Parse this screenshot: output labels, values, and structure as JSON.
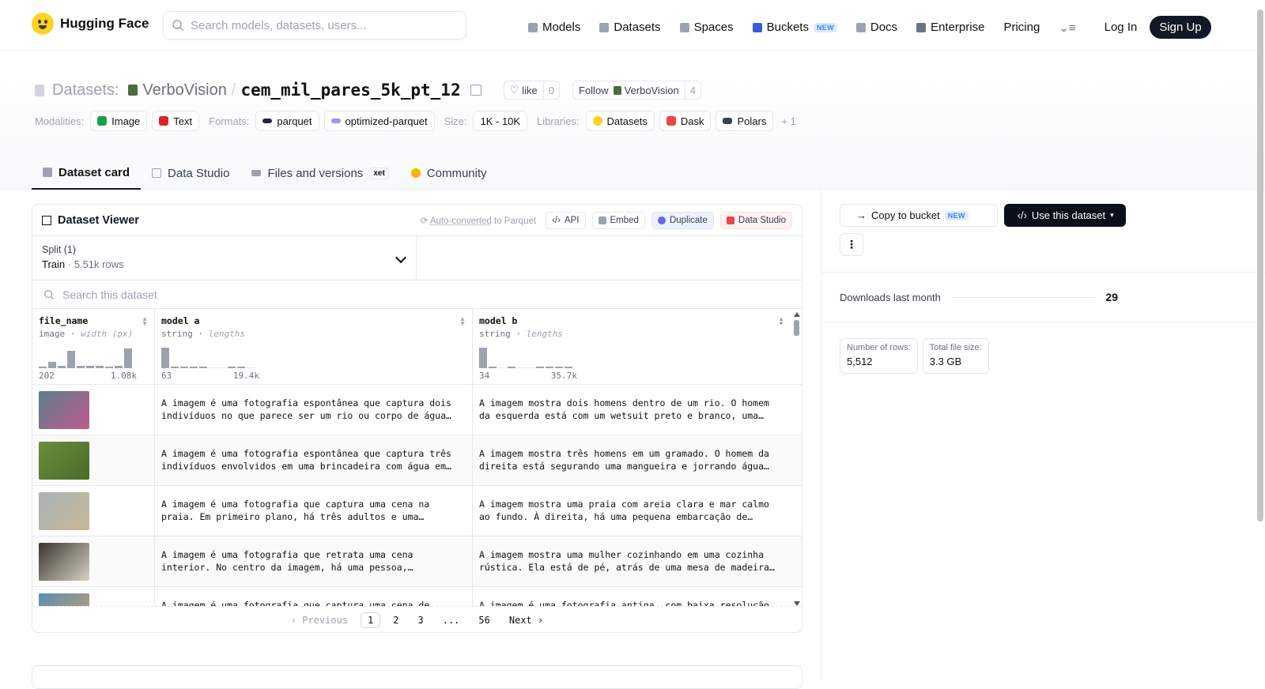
{
  "brand": {
    "name": "Hugging Face"
  },
  "search": {
    "placeholder": "Search models, datasets, users..."
  },
  "nav": {
    "links": [
      "Models",
      "Datasets",
      "Spaces",
      "Buckets",
      "Docs",
      "Enterprise",
      "Pricing"
    ],
    "new_badge": "NEW",
    "login": "Log In",
    "signup": "Sign Up"
  },
  "dataset": {
    "prefix": "Datasets:",
    "owner": "VerboVision",
    "slash": "/",
    "name": "cem_mil_pares_5k_pt_12",
    "like_label": "like",
    "like_count": "0",
    "follow_label": "Follow",
    "follow_owner": "VerboVision",
    "follow_count": "4"
  },
  "tags": {
    "modalities_label": "Modalities:",
    "modalities": [
      "Image",
      "Text"
    ],
    "formats_label": "Formats:",
    "formats": [
      "parquet",
      "optimized-parquet"
    ],
    "size_label": "Size:",
    "size": "1K - 10K",
    "libraries_label": "Libraries:",
    "libraries": [
      "Datasets",
      "Dask",
      "Polars"
    ],
    "more": "+ 1"
  },
  "tabs": [
    "Dataset card",
    "Data Studio",
    "Files and versions",
    "Community"
  ],
  "tab_badge": "xet",
  "viewer": {
    "title": "Dataset Viewer",
    "autoconv_link": "Auto-converted",
    "autoconv_rest": "to Parquet",
    "api": "API",
    "embed": "Embed",
    "duplicate": "Duplicate",
    "data_studio": "Data Studio",
    "split_label": "Split (1)",
    "split_name": "Train",
    "split_sep": "·",
    "split_rows": "5.51k rows",
    "search_placeholder": "Search this dataset",
    "columns": [
      {
        "name": "file_name",
        "type": "image",
        "stat": "width (px)",
        "min": "202",
        "max": "1.08k"
      },
      {
        "name": "model a",
        "type": "string",
        "stat": "lengths",
        "min": "63",
        "max": "19.4k"
      },
      {
        "name": "model b",
        "type": "string",
        "stat": "lengths",
        "min": "34",
        "max": "35.7k"
      }
    ],
    "type_sep": " · ",
    "hist": [
      [
        0.08,
        0.3,
        0.1,
        0.85,
        0.12,
        0.1,
        0.1,
        0.06,
        0.1,
        0.95
      ],
      [
        1.0,
        0.08,
        0.06,
        0.06,
        0.06,
        0.0,
        0.0,
        0.06,
        0.06,
        0.0
      ],
      [
        1.0,
        0.06,
        0.0,
        0.06,
        0.0,
        0.0,
        0.06,
        0.06,
        0.06,
        0.06
      ]
    ],
    "rows": [
      {
        "thumb": "#5a7f8c",
        "thumb2": "#c25a8e",
        "a": "A imagem é uma fotografia espontânea que captura dois indivíduos no que parece ser um rio ou corpo de água…",
        "b": "A imagem mostra dois homens dentro de um rio. O homem da esquerda está com um wetsuit preto e branco, uma…"
      },
      {
        "thumb": "#6b8e3a",
        "thumb2": "#4a6a2a",
        "a": "A imagem é uma fotografia espontânea que captura três indivíduos envolvidos em uma brincadeira com água em…",
        "b": "A imagem mostra três homens em um gramado. O homem da direita está segurando uma mangueira e jorrando água…"
      },
      {
        "thumb": "#a8b3b5",
        "thumb2": "#c9b79a",
        "a": "A imagem é uma fotografia que captura uma cena na praia. Em primeiro plano, há três adultos e uma…",
        "b": "A imagem mostra uma praia com areia clara e mar calmo ao fundo. À direita, há uma pequena embarcação de…"
      },
      {
        "thumb": "#3a3530",
        "thumb2": "#d8d2c4",
        "a": "A imagem é uma fotografia que retrata uma cena interior. No centro da imagem, há uma pessoa,…",
        "b": "A imagem mostra uma mulher cozinhando em uma cozinha rústica. Ela está de pé, atrás de uma mesa de madeira…"
      },
      {
        "thumb": "#5b8fb0",
        "thumb2": "#c8a070",
        "a": "A imagem é uma fotografia que captura uma cena de…",
        "b": "A imagem é uma fotografia antiga, com baixa resolução…"
      }
    ],
    "pager": {
      "prev": "Previous",
      "pages": [
        "1",
        "2",
        "3",
        "...",
        "56"
      ],
      "next": "Next"
    }
  },
  "sidebar": {
    "copy_bucket": "Copy to bucket",
    "new_badge": "NEW",
    "use_dataset": "Use this dataset",
    "kebab": "⋮",
    "downloads_label": "Downloads last month",
    "downloads": "29",
    "rows_label": "Number of rows:",
    "rows": "5,512",
    "size_label": "Total file size:",
    "size": "3.3 GB"
  },
  "colors": {
    "accent_dark": "#111827",
    "new_badge": "#3b82f6"
  }
}
